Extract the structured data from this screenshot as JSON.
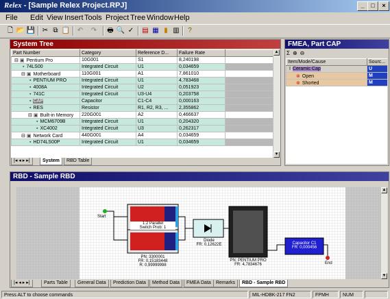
{
  "window": {
    "app_name": "Relex",
    "title": " - [Sample Relex Project.RPJ]"
  },
  "menu": [
    "File",
    "Edit",
    "View",
    "Insert",
    "Tools",
    "Project",
    "Tree",
    "Window",
    "Help"
  ],
  "system_tree": {
    "title": "System Tree",
    "columns": [
      "Part Number",
      "Category",
      "Reference D...",
      "Failure Rate"
    ],
    "rows": [
      {
        "part": "Pentium Pro",
        "category": "10G001",
        "ref": "S1",
        "rate": "8,240198",
        "level": 0,
        "expander": "⊟",
        "highlight": false
      },
      {
        "part": "74LS00",
        "category": "Integrated Circuit",
        "ref": "U1",
        "rate": "0,034659",
        "level": 1,
        "expander": "",
        "highlight": true
      },
      {
        "part": "Motherboard",
        "category": "110G001",
        "ref": "A1",
        "rate": "7,861010",
        "level": 1,
        "expander": "⊟",
        "highlight": false
      },
      {
        "part": "PENTIUM PRO",
        "category": "Integrated Circuit",
        "ref": "U1",
        "rate": "4,783468",
        "level": 2,
        "expander": "",
        "highlight": true
      },
      {
        "part": "4008A",
        "category": "Integrated Circuit",
        "ref": "U2",
        "rate": "0,051923",
        "level": 2,
        "expander": "",
        "highlight": true
      },
      {
        "part": "741C",
        "category": "Integrated Circuit",
        "ref": "U3-U4",
        "rate": "0,203758",
        "level": 2,
        "expander": "",
        "highlight": true
      },
      {
        "part": "CAP",
        "category": "Capacitor",
        "ref": "C1-C4",
        "rate": "0,000163",
        "level": 2,
        "expander": "",
        "highlight": true
      },
      {
        "part": "RES",
        "category": "Resistor",
        "ref": "R1, R2, R3, ...",
        "rate": "2,355862",
        "level": 2,
        "expander": "",
        "highlight": true
      },
      {
        "part": "Built-in Memory",
        "category": "220G001",
        "ref": "A2",
        "rate": "0,466637",
        "level": 2,
        "expander": "⊟",
        "highlight": false
      },
      {
        "part": "MCM6709B",
        "category": "Integrated Circuit",
        "ref": "U1",
        "rate": "0,204320",
        "level": 3,
        "expander": "",
        "highlight": true
      },
      {
        "part": "XC4002",
        "category": "Integrated Circuit",
        "ref": "U3",
        "rate": "0,262317",
        "level": 3,
        "expander": "",
        "highlight": true
      },
      {
        "part": "Network Card",
        "category": "440G001",
        "ref": "A4",
        "rate": "0,034659",
        "level": 1,
        "expander": "⊟",
        "highlight": false
      },
      {
        "part": "HD74LS00P",
        "category": "Integrated Circuit",
        "ref": "U1",
        "rate": "0,034659",
        "level": 2,
        "expander": "",
        "highlight": true
      }
    ],
    "tabs": [
      "System",
      "RBD Table"
    ]
  },
  "fmea": {
    "title": "FMEA, Part CAP",
    "columns": [
      "Item/Mode/Cause",
      "Sourc..."
    ],
    "rows": [
      {
        "label": "Ceramic Cap",
        "icon": "I",
        "source": "U"
      },
      {
        "label": "Open",
        "icon": "x",
        "source": "M"
      },
      {
        "label": "Shorted",
        "icon": "x",
        "source": "M"
      }
    ]
  },
  "rbd": {
    "title": "RBD - Sample RBD",
    "start": "Start",
    "end": "End",
    "parallel": {
      "line1": "1:2 Parallel",
      "line2": "Switch Prob: 1"
    },
    "block_pn": {
      "pn": "PN: 3300001",
      "fr": "FR: 0,15183448",
      "r": "R: 0,99999998"
    },
    "diode": {
      "name": "Diode",
      "fr": "FR: 0,12622E"
    },
    "pentium": {
      "pn": "PN: PENTIUM PRO",
      "fr": "FR: 4,7834676"
    },
    "capacitor": {
      "name": "Capacitor C1",
      "fr": "FR: 0,000456"
    },
    "tabs": [
      "Parts Table",
      "General Data",
      "Prediction Data",
      "Method Data",
      "FMEA Data",
      "Remarks",
      "RBD - Sample RBD"
    ]
  },
  "status": {
    "hint": "Press ALT to choose commands",
    "standard": "MIL-HDBK-217 FN2",
    "units": "FPMH",
    "num": "NUM"
  }
}
